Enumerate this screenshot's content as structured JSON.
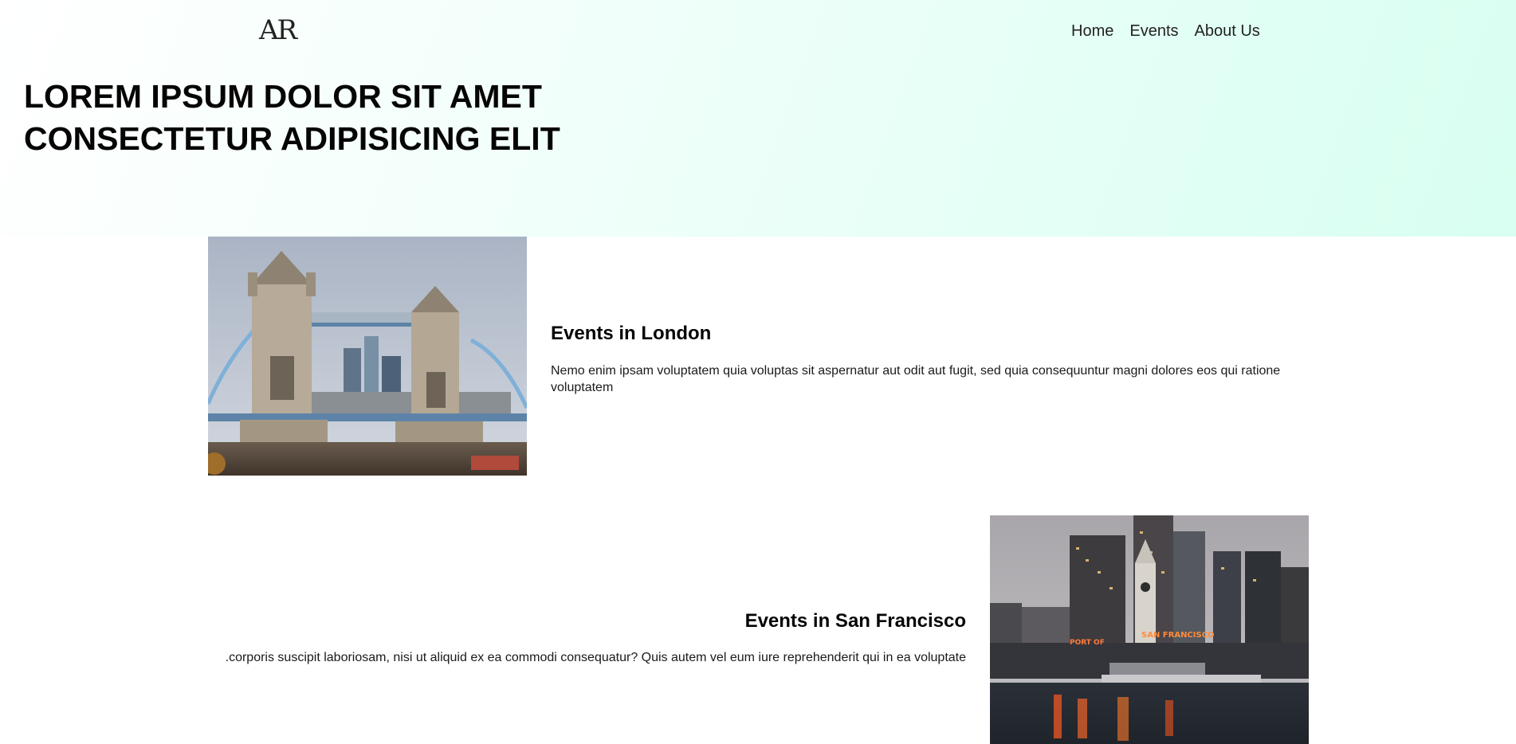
{
  "header": {
    "logo_text": "AR",
    "nav": [
      {
        "label": "Home"
      },
      {
        "label": "Events"
      },
      {
        "label": "About Us"
      }
    ]
  },
  "hero": {
    "title": "LOREM IPSUM DOLOR SIT AMET CONSECTETUR ADIPISICING ELIT"
  },
  "events": [
    {
      "title": "Events in London",
      "description": "Nemo enim ipsam voluptatem quia voluptas sit aspernatur aut odit aut fugit, sed quia consequuntur magni dolores eos qui ratione voluptatem",
      "image_sign_text": ""
    },
    {
      "title": "Events in San Francisco",
      "description": ".corporis suscipit laboriosam, nisi ut aliquid ex ea commodi consequatur? Quis autem vel eum iure reprehenderit qui in ea voluptate",
      "image_sign_text": "SAN FRANCISCO",
      "image_sign_text_2": "PORT OF"
    }
  ],
  "colors": {
    "hero_gradient_end": "#d8fff1",
    "text": "#050505"
  }
}
